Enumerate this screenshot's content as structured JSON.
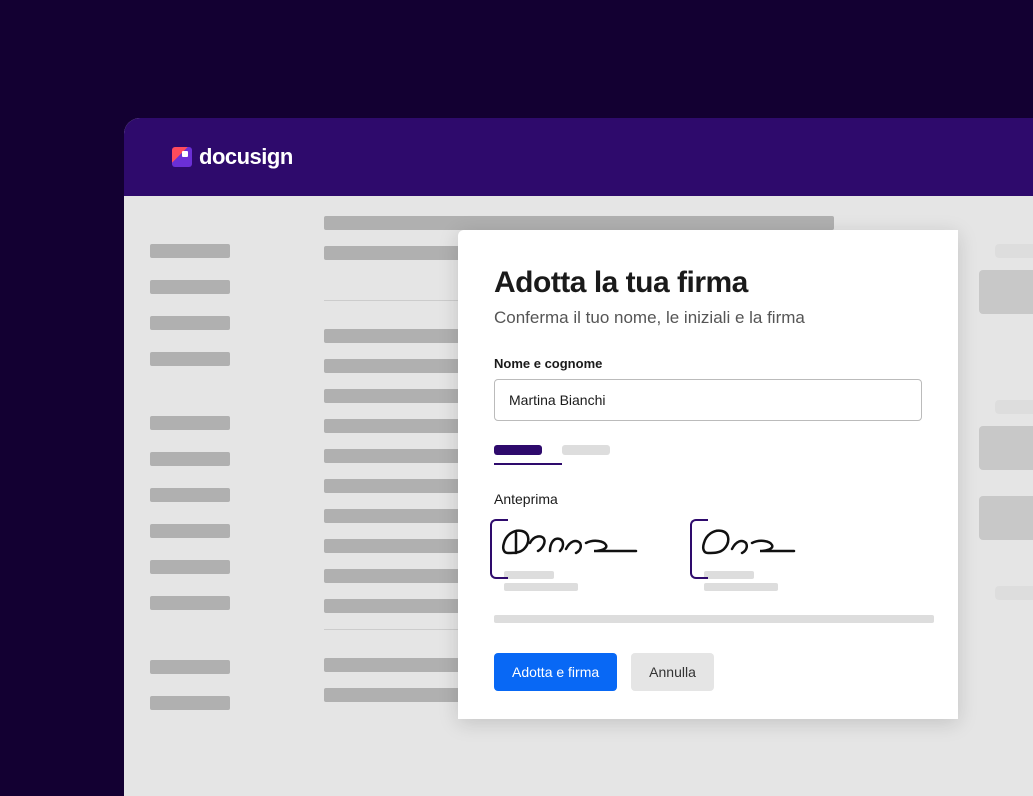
{
  "brand": {
    "name": "docusign"
  },
  "modal": {
    "title": "Adotta la tua firma",
    "subtitle": "Conferma il tuo nome, le iniziali e la firma",
    "name_label": "Nome e cognome",
    "name_value": "Martina Bianchi",
    "preview_label": "Anteprima",
    "adopt_button": "Adotta e firma",
    "cancel_button": "Annulla"
  }
}
